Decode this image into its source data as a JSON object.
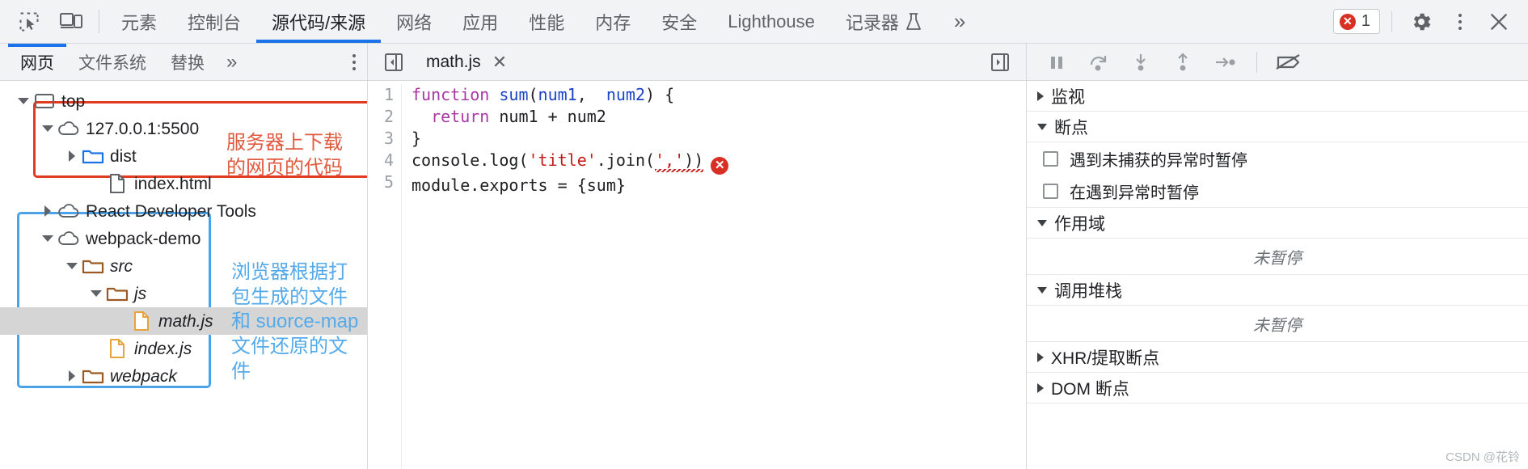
{
  "toolbar": {
    "inspect_icon": "inspect-cursor-icon",
    "device_icon": "device-toolbar-icon",
    "tabs": [
      {
        "label": "元素",
        "active": false
      },
      {
        "label": "控制台",
        "active": false
      },
      {
        "label": "源代码/来源",
        "active": true
      },
      {
        "label": "网络",
        "active": false
      },
      {
        "label": "应用",
        "active": false
      },
      {
        "label": "性能",
        "active": false
      },
      {
        "label": "内存",
        "active": false
      },
      {
        "label": "安全",
        "active": false
      },
      {
        "label": "Lighthouse",
        "active": false
      },
      {
        "label": "记录器",
        "active": false,
        "icon": "flask-icon"
      }
    ],
    "overflow": "»",
    "error_count": "1",
    "error_icon": "error-circle-icon",
    "settings_icon": "gear-icon",
    "more_icon": "kebab-menu-icon",
    "close_icon": "close-icon"
  },
  "navigator": {
    "subtabs": [
      {
        "label": "网页",
        "active": true
      },
      {
        "label": "文件系统",
        "active": false
      },
      {
        "label": "替换",
        "active": false
      }
    ],
    "overflow": "»",
    "more_icon": "kebab-menu-icon",
    "tree": [
      {
        "label": "top",
        "icon": "frame-icon",
        "twisty": "open",
        "indent": 0,
        "italic": false,
        "selected": false
      },
      {
        "label": "127.0.0.1:5500",
        "icon": "cloud-icon",
        "twisty": "open",
        "indent": 1,
        "italic": false,
        "selected": false
      },
      {
        "label": "dist",
        "icon": "folder-blue-icon",
        "twisty": "closed",
        "indent": 2,
        "italic": false,
        "selected": false
      },
      {
        "label": "index.html",
        "icon": "file-gray-icon",
        "twisty": "blank",
        "indent": 3,
        "italic": false,
        "selected": false
      },
      {
        "label": "React Developer Tools",
        "icon": "cloud-icon",
        "twisty": "closed",
        "indent": 1,
        "italic": false,
        "selected": false
      },
      {
        "label": "webpack-demo",
        "icon": "cloud-icon",
        "twisty": "open",
        "indent": 1,
        "italic": false,
        "selected": false
      },
      {
        "label": "src",
        "icon": "folder-brown-icon",
        "twisty": "open",
        "indent": 2,
        "italic": true,
        "selected": false
      },
      {
        "label": "js",
        "icon": "folder-brown-icon",
        "twisty": "open",
        "indent": 3,
        "italic": true,
        "selected": false
      },
      {
        "label": "math.js",
        "icon": "file-orange-icon",
        "twisty": "blank",
        "indent": 4,
        "italic": true,
        "selected": true
      },
      {
        "label": "index.js",
        "icon": "file-orange-icon",
        "twisty": "blank",
        "indent": 3,
        "italic": true,
        "selected": false
      },
      {
        "label": "webpack",
        "icon": "folder-brown-icon",
        "twisty": "closed",
        "indent": 2,
        "italic": true,
        "selected": false
      }
    ],
    "annotations": [
      {
        "id": "red",
        "text": "服务器上下载\n的网页的代码",
        "color": "#e05a3f",
        "box_color": "#e23b21"
      },
      {
        "id": "blue",
        "text": "浏览器根据打\n包生成的文件\n和 suorce-map\n文件还原的文\n件",
        "color": "#55aaea",
        "box_color": "#4aa3e8"
      }
    ]
  },
  "editor": {
    "show_navigator_icon": "show-navigator-panel-icon",
    "show_debugger_icon": "show-debugger-panel-icon",
    "file_tab": {
      "name": "math.js",
      "close_icon": "close-icon"
    },
    "line_numbers": [
      "1",
      "2",
      "3",
      "4",
      "5"
    ],
    "code_lines": [
      "function sum(num1,  num2) {",
      "  return num1 + num2",
      "}",
      "console.log('title'.join(','))",
      "module.exports = {sum}"
    ],
    "error_marker_icon": "error-circle-icon"
  },
  "debugger": {
    "controls": [
      {
        "icon": "pause-icon",
        "name": "pause-script-execution"
      },
      {
        "icon": "step-over-icon",
        "name": "step-over-next-function-call"
      },
      {
        "icon": "step-into-icon",
        "name": "step-into-next-function-call"
      },
      {
        "icon": "step-out-icon",
        "name": "step-out-of-current-function"
      },
      {
        "icon": "step-icon",
        "name": "step"
      },
      {
        "icon": "deactivate-breakpoints-icon",
        "name": "deactivate-breakpoints"
      }
    ],
    "sections": [
      {
        "title": "监视",
        "state": "collapsed",
        "body": null
      },
      {
        "title": "断点",
        "state": "expanded",
        "checkboxes": [
          {
            "label": "遇到未捕获的异常时暂停",
            "checked": false
          },
          {
            "label": "在遇到异常时暂停",
            "checked": false
          }
        ]
      },
      {
        "title": "作用域",
        "state": "expanded",
        "empty_text": "未暂停"
      },
      {
        "title": "调用堆栈",
        "state": "expanded",
        "empty_text": "未暂停"
      },
      {
        "title": "XHR/提取断点",
        "state": "collapsed",
        "body": null
      },
      {
        "title": "DOM 断点",
        "state": "collapsed",
        "body": null
      }
    ]
  },
  "watermark": "CSDN @花铃"
}
